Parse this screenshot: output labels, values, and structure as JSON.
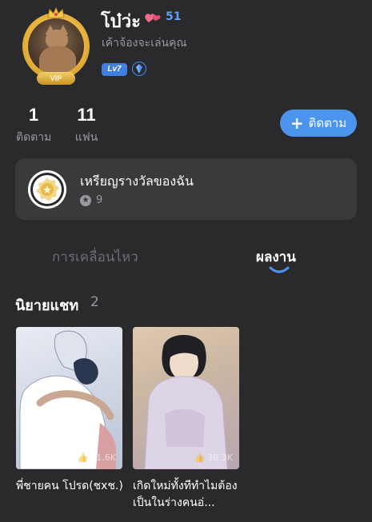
{
  "profile": {
    "username": "โบ๋ว่ะ",
    "heart_count": "51",
    "bio": "เค้าจ้องจะเล่นคุณ",
    "vip_label": "VIP",
    "level": "Lv7"
  },
  "stats": {
    "following_count": "1",
    "following_label": "ติดตาม",
    "fans_count": "11",
    "fans_label": "แฟน"
  },
  "follow_button": {
    "label": "ติดตาม"
  },
  "medal": {
    "title": "เหรียญรางวัลของฉัน",
    "count": "9"
  },
  "tabs": [
    {
      "label": "การเคลื่อนไหว",
      "active": false
    },
    {
      "label": "ผลงาน",
      "active": true
    }
  ],
  "section": {
    "title": "นิยายแชท",
    "count": "2"
  },
  "works": [
    {
      "title": "พี่ชายคน โปรด(ชxช.)",
      "views": "11.6K"
    },
    {
      "title": "เกิดใหม่ทั้งทีทำไมต้องเป็นในร่างคนอ่...",
      "views": "30.3K"
    }
  ],
  "colors": {
    "background": "#2a2a2c",
    "card": "#3a3a3d",
    "accent_blue": "#4c95ee",
    "heart_pink": "#f26b8a",
    "muted_text": "#9a9a9e"
  },
  "icons": {
    "heart": "hearts-icon",
    "shield": "shield-badge-icon",
    "plus": "plus-icon",
    "medal": "medal-icon",
    "star": "star-icon",
    "views": "like-icon"
  }
}
